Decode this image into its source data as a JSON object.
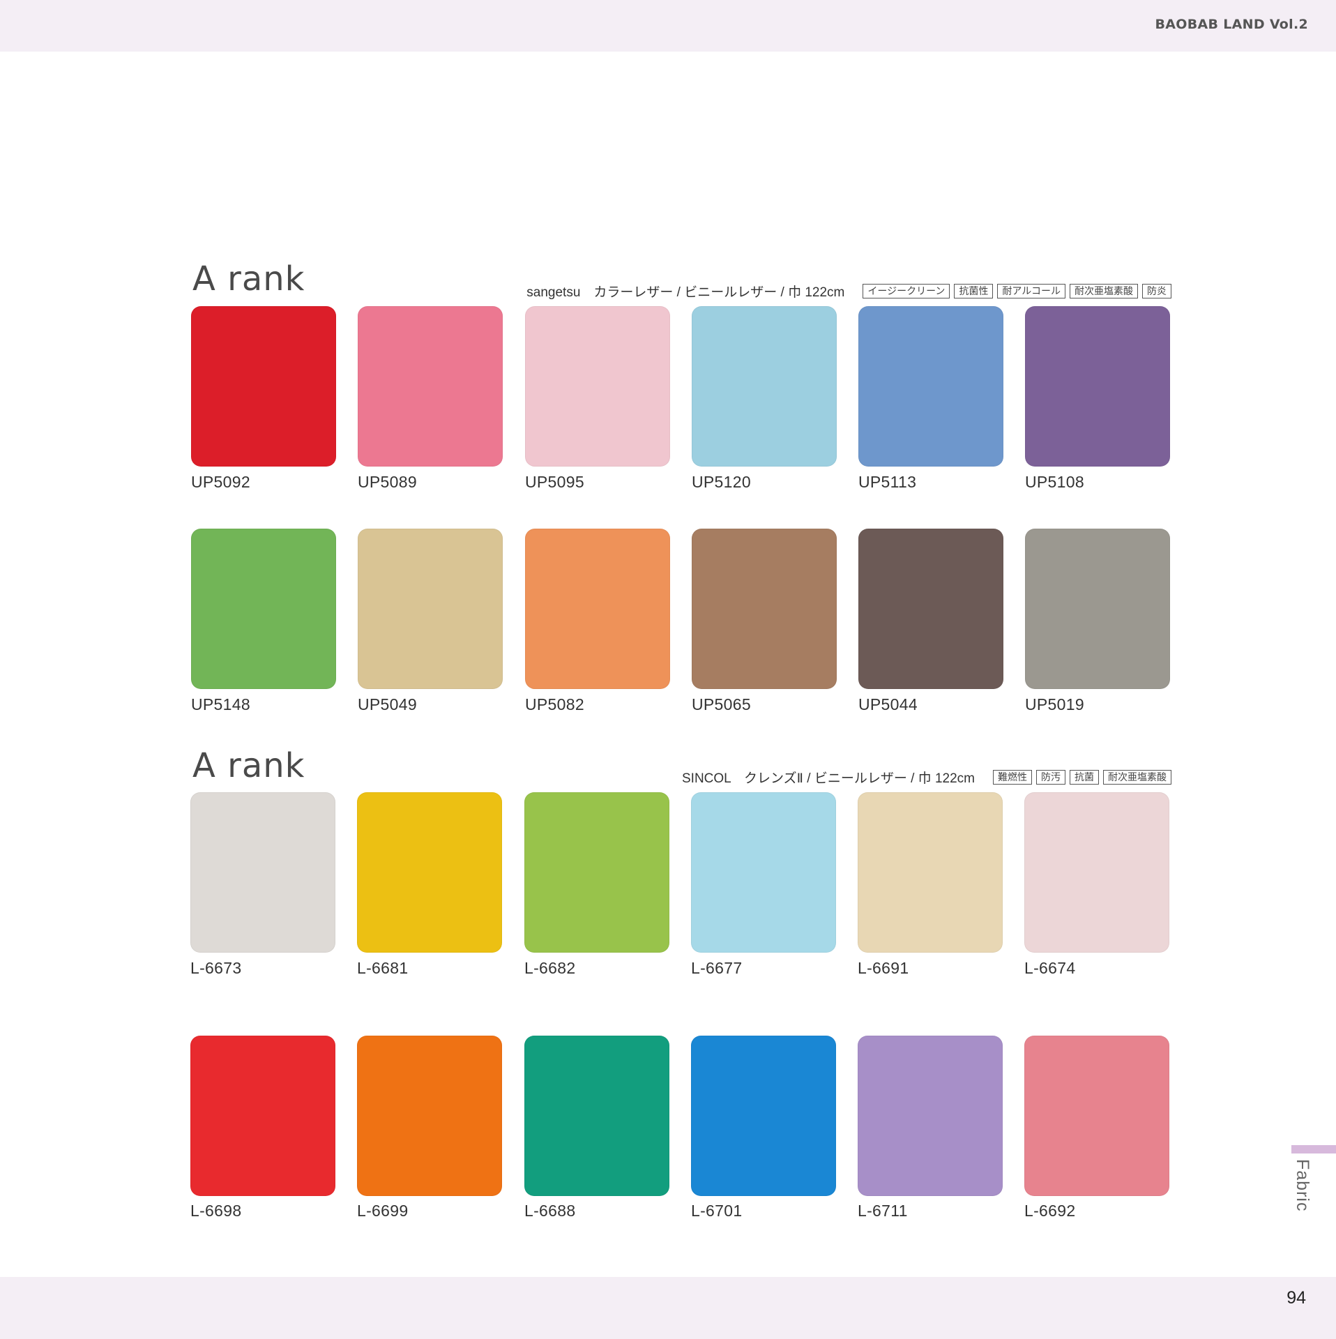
{
  "header": {
    "brand": "BAOBAB LAND Vol.2"
  },
  "footer": {
    "page_number": "94"
  },
  "side_tab": {
    "label": "Fabric",
    "color": "#d7b9dc"
  },
  "sections": [
    {
      "title": "A rank",
      "spec": "sangetsu　カラーレザー / ビニールレザー / 巾 122cm",
      "tags": [
        "イージークリーン",
        "抗菌性",
        "耐アルコール",
        "耐次亜塩素酸",
        "防炎"
      ],
      "swatches": [
        {
          "code": "UP5092",
          "color": "#dc1e29"
        },
        {
          "code": "UP5089",
          "color": "#ec7891"
        },
        {
          "code": "UP5095",
          "color": "#f0c6cf"
        },
        {
          "code": "UP5120",
          "color": "#9ccfe0"
        },
        {
          "code": "UP5113",
          "color": "#6e97cc"
        },
        {
          "code": "UP5108",
          "color": "#7c6198"
        },
        {
          "code": "UP5148",
          "color": "#72b557"
        },
        {
          "code": "UP5049",
          "color": "#d9c494"
        },
        {
          "code": "UP5082",
          "color": "#ee9259"
        },
        {
          "code": "UP5065",
          "color": "#a67d61"
        },
        {
          "code": "UP5044",
          "color": "#6c5a56"
        },
        {
          "code": "UP5019",
          "color": "#9b9890"
        }
      ]
    },
    {
      "title": "A rank",
      "spec": "SINCOL　クレンズⅡ / ビニールレザー / 巾 122cm",
      "tags": [
        "難燃性",
        "防汚",
        "抗菌",
        "耐次亜塩素酸"
      ],
      "swatches": [
        {
          "code": "L-6673",
          "color": "#dedad6"
        },
        {
          "code": "L-6681",
          "color": "#ecc013"
        },
        {
          "code": "L-6682",
          "color": "#98c34b"
        },
        {
          "code": "L-6677",
          "color": "#a6d9e8"
        },
        {
          "code": "L-6691",
          "color": "#e8d7b4"
        },
        {
          "code": "L-6674",
          "color": "#ecd6d7"
        },
        {
          "code": "L-6698",
          "color": "#e82a2e"
        },
        {
          "code": "L-6699",
          "color": "#ef7214"
        },
        {
          "code": "L-6688",
          "color": "#129e7e"
        },
        {
          "code": "L-6701",
          "color": "#1a87d4"
        },
        {
          "code": "L-6711",
          "color": "#a78fc8"
        },
        {
          "code": "L-6692",
          "color": "#e7838e"
        }
      ]
    }
  ]
}
